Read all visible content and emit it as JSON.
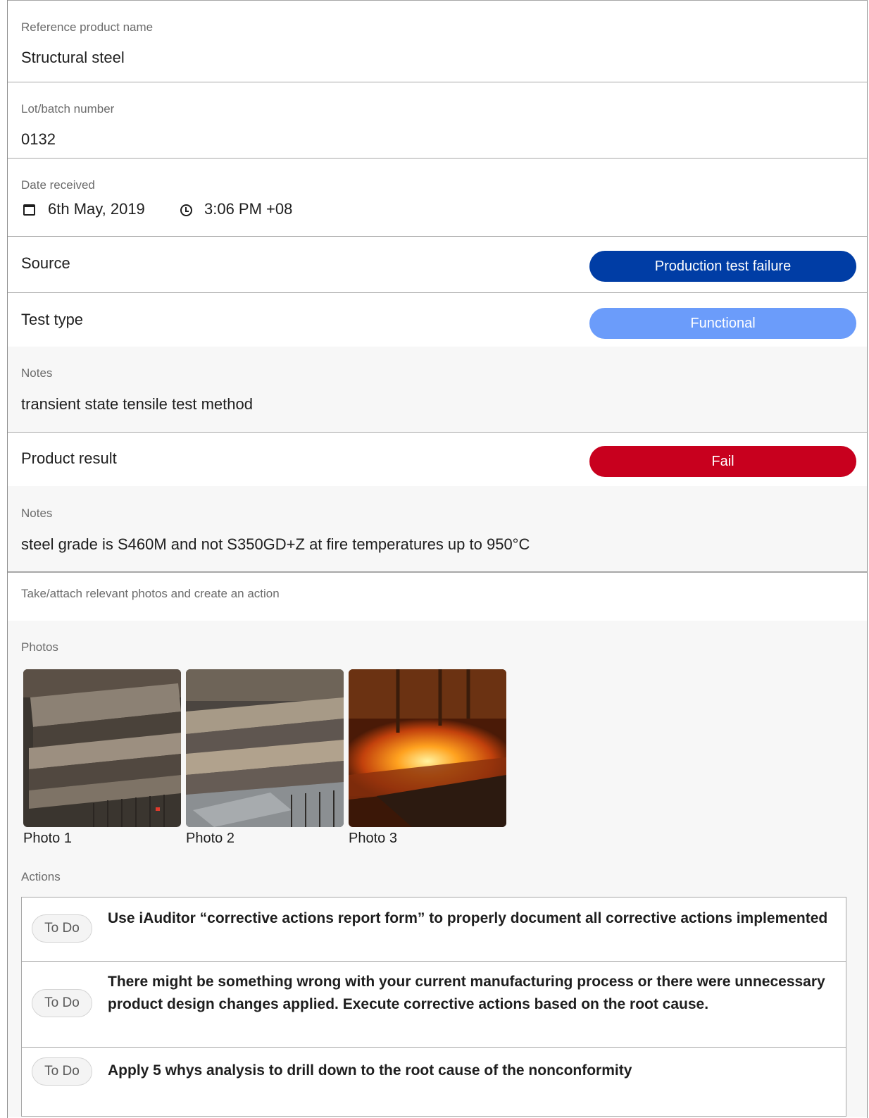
{
  "fields": {
    "product_name": {
      "label": "Reference product name",
      "value": "Structural steel"
    },
    "lot_number": {
      "label": "Lot/batch number",
      "value": "0132"
    },
    "date_received": {
      "label": "Date received",
      "date": "6th May, 2019",
      "time": "3:06 PM +08"
    }
  },
  "source": {
    "label": "Source",
    "response": "Production test failure",
    "color": "#003da5"
  },
  "test_type": {
    "label": "Test type",
    "response": "Functional",
    "color": "#6b9cfa"
  },
  "test_notes": {
    "label": "Notes",
    "value": "transient state tensile test method"
  },
  "product_result": {
    "label": "Product result",
    "response": "Fail",
    "color": "#c8001e"
  },
  "result_notes": {
    "label": "Notes",
    "value": "steel grade is S460M and not S350GD+Z at fire temperatures up to 950°C"
  },
  "media_section": {
    "label": "Take/attach relevant photos and create an action",
    "photos_label": "Photos",
    "photos": [
      {
        "caption": "Photo 1",
        "subject": "stacked steel channels"
      },
      {
        "caption": "Photo 2",
        "subject": "stacked steel channels with markings"
      },
      {
        "caption": "Photo 3",
        "subject": "hot steel processing furnace"
      }
    ],
    "actions_label": "Actions",
    "actions": [
      {
        "status": "To Do",
        "text": "Use iAuditor “corrective actions report form” to properly document all corrective actions implemented"
      },
      {
        "status": "To Do",
        "text": "There might be something wrong with your current manufacturing process or there were unnecessary product design changes applied. Execute corrective actions based on the root cause."
      },
      {
        "status": "To Do",
        "text": "Apply 5 whys analysis to drill down to the root cause of the nonconformity"
      }
    ]
  }
}
